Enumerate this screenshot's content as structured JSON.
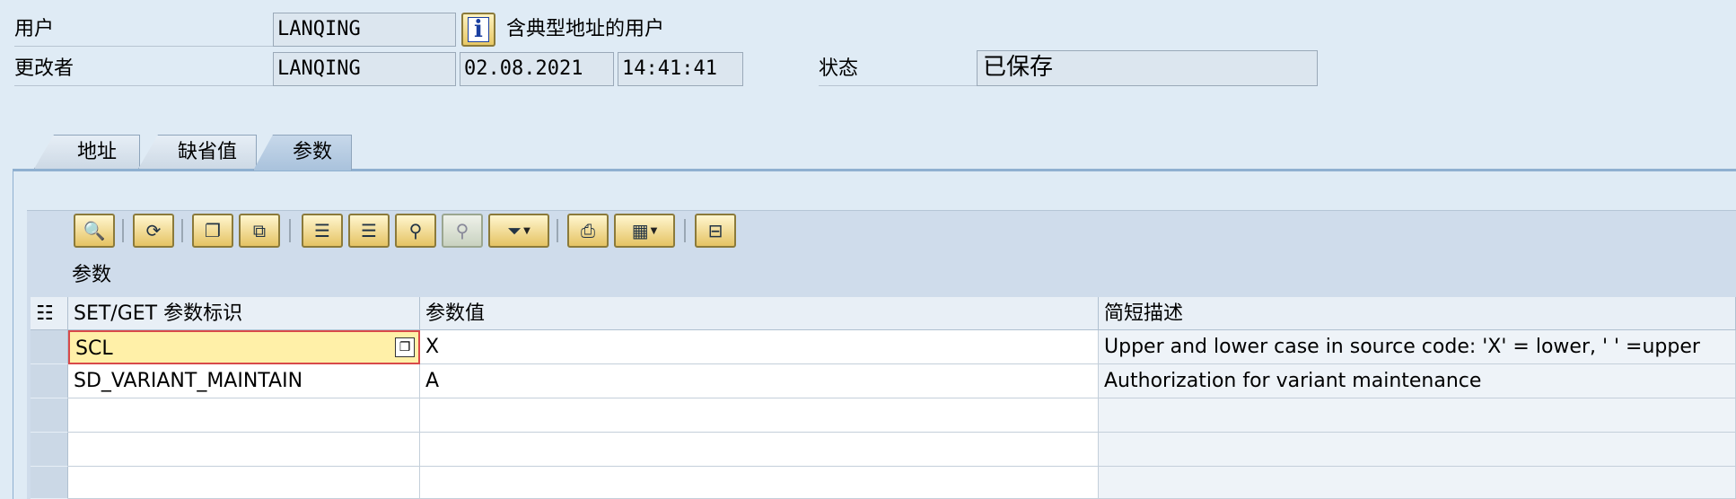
{
  "header": {
    "user_label": "用户",
    "user_value": "LANQING",
    "user_description": "含典型地址的用户",
    "changed_by_label": "更改者",
    "changed_by_value": "LANQING",
    "changed_date": "02.08.2021",
    "changed_time": "14:41:41",
    "status_label": "状态",
    "status_value": "已保存"
  },
  "tabs": [
    {
      "label": "地址",
      "active": false
    },
    {
      "label": "缺省值",
      "active": false
    },
    {
      "label": "参数",
      "active": true
    }
  ],
  "toolbar": {
    "icons": [
      "details-icon",
      "refresh-icon",
      "copy-row-icon",
      "copy-icon",
      "sort-ascending-icon",
      "sort-descending-icon",
      "find-icon",
      "find-next-icon",
      "filter-icon",
      "print-icon",
      "layout-icon",
      "delete-row-icon"
    ]
  },
  "grid": {
    "title": "参数",
    "columns": [
      "SET/GET 参数标识",
      "参数值",
      "简短描述"
    ],
    "rows": [
      {
        "param_id": "SCL",
        "value": "X",
        "description": "Upper and lower case in source code: 'X' = lower, ' ' =upper"
      },
      {
        "param_id": "SD_VARIANT_MAINTAIN",
        "value": "A",
        "description": "Authorization for variant maintenance"
      },
      {
        "param_id": "",
        "value": "",
        "description": ""
      },
      {
        "param_id": "",
        "value": "",
        "description": ""
      },
      {
        "param_id": "",
        "value": "",
        "description": ""
      }
    ]
  },
  "colors": {
    "accent_tab": "#a9c2dc",
    "selected_cell": "#fff0a8",
    "selected_border": "#d84a4a"
  }
}
